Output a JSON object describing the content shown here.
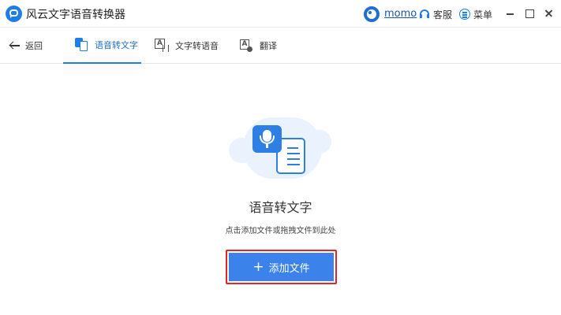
{
  "app": {
    "title": "风云文字语音转换器"
  },
  "user": {
    "name": "momo"
  },
  "titlebar": {
    "service_label": "客服",
    "menu_label": "菜单"
  },
  "colors": {
    "accent": "#1f7ee6",
    "button": "#3b82ea",
    "highlight_border": "#e0262a"
  },
  "nav": {
    "back_label": "返回",
    "tabs": [
      {
        "label": "语音转文字",
        "icon": "speech-to-text-icon",
        "active": true
      },
      {
        "label": "文字转语音",
        "icon": "text-to-speech-icon",
        "active": false
      },
      {
        "label": "翻译",
        "icon": "translate-icon",
        "active": false
      }
    ]
  },
  "main": {
    "title": "语音转文字",
    "hint": "点击添加文件或拖拽文件到此处",
    "add_button": {
      "plus": "+",
      "label": "添加文件"
    }
  }
}
